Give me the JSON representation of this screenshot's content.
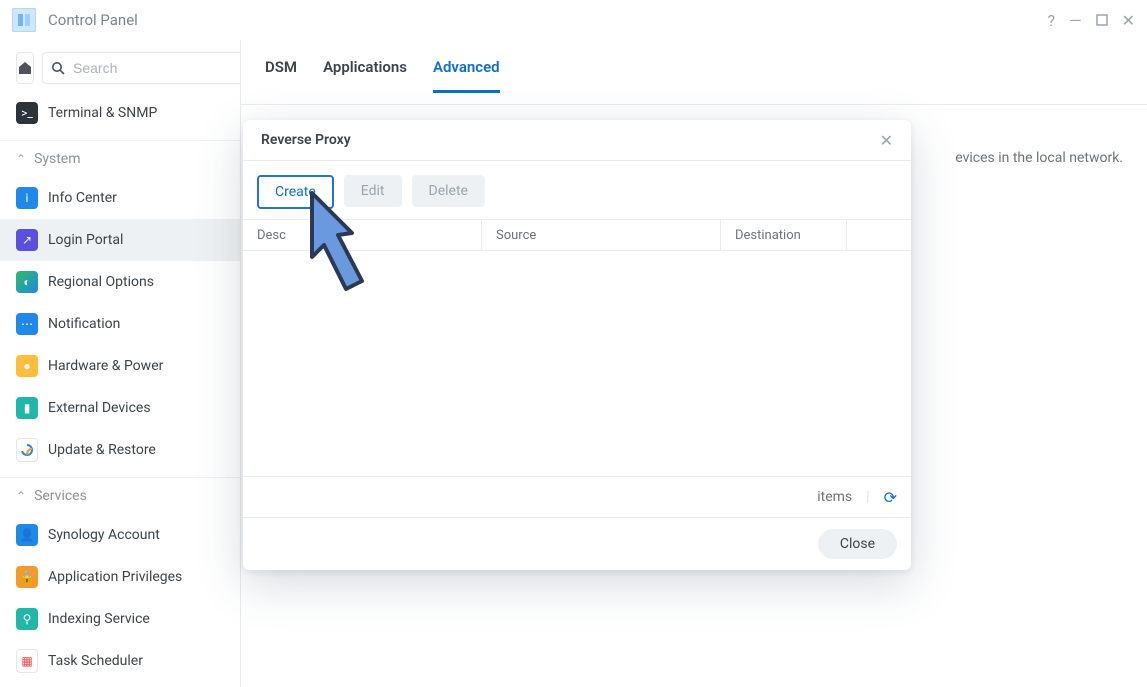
{
  "window": {
    "title": "Control Panel"
  },
  "search": {
    "placeholder": "Search"
  },
  "sidebar": {
    "top_item": {
      "label": "Terminal & SNMP"
    },
    "groups": [
      {
        "label": "System",
        "items": [
          {
            "label": "Info Center"
          },
          {
            "label": "Login Portal"
          },
          {
            "label": "Regional Options"
          },
          {
            "label": "Notification"
          },
          {
            "label": "Hardware & Power"
          },
          {
            "label": "External Devices"
          },
          {
            "label": "Update & Restore"
          }
        ]
      },
      {
        "label": "Services",
        "items": [
          {
            "label": "Synology Account"
          },
          {
            "label": "Application Privileges"
          },
          {
            "label": "Indexing Service"
          },
          {
            "label": "Task Scheduler"
          }
        ]
      }
    ]
  },
  "tabs": {
    "items": [
      "DSM",
      "Applications",
      "Advanced"
    ],
    "active_index": 2
  },
  "page": {
    "section_title": "Reverse Proxy",
    "section_desc_tail": "evices in the local network."
  },
  "modal": {
    "title": "Reverse Proxy",
    "buttons": {
      "create": "Create",
      "edit": "Edit",
      "delete": "Delete"
    },
    "columns": [
      "Description",
      "Source",
      "Destination"
    ],
    "col0_visible": "Desc",
    "status": "items",
    "close": "Close"
  }
}
